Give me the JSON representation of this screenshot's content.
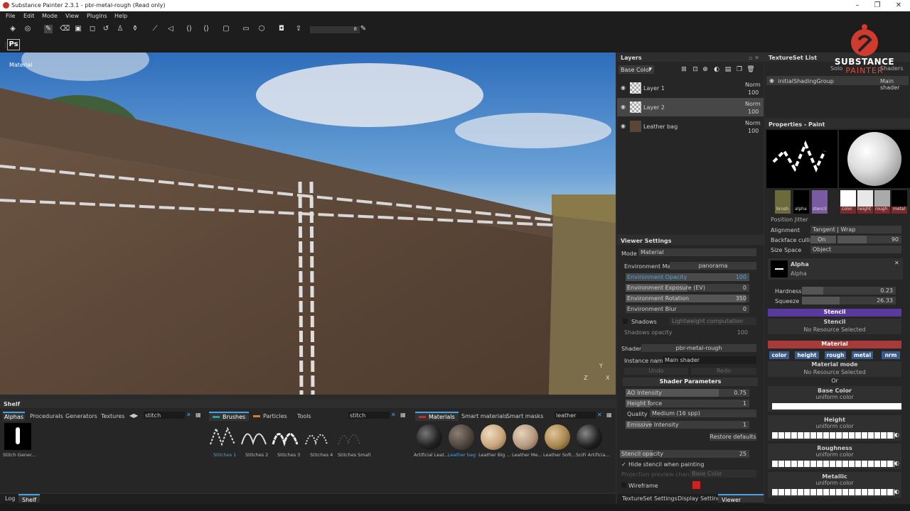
{
  "window": {
    "title": "Substance Painter 2.3.1 - pbr-metal-rough (Read only)",
    "min": "–",
    "max": "❐",
    "close": "✕"
  },
  "menu": [
    "File",
    "Edit",
    "Mode",
    "View",
    "Plugins",
    "Help"
  ],
  "toolbar": {
    "brush_size_value": "8",
    "ps_label": "Ps"
  },
  "viewport": {
    "label": "Material",
    "axis_z": "Z",
    "axis_x": "X",
    "axis_y": "Y"
  },
  "brand": {
    "line1": "SUBSTANCE",
    "line2": "PAINTER"
  },
  "layers": {
    "title": "Layers",
    "channel": "Base Color",
    "items": [
      {
        "name": "Layer 1",
        "blend": "Norm",
        "opacity": "100"
      },
      {
        "name": "Layer 2",
        "blend": "Norm",
        "opacity": "100"
      },
      {
        "name": "Leather bag",
        "blend": "Norm",
        "opacity": "100"
      }
    ]
  },
  "textureset": {
    "title": "TextureSet List",
    "solo": "Solo",
    "shaders": "Shaders",
    "item": "initialShadingGroup",
    "shader": "Main shader"
  },
  "properties": {
    "title": "Properties - Paint",
    "chips_left": [
      "brush",
      "alpha",
      "stencil"
    ],
    "chips_right": [
      "color",
      "height",
      "rough",
      "metal"
    ],
    "position_jitter": "Position Jitter",
    "alignment_label": "Alignment",
    "alignment_value": "Tangent | Wrap",
    "backface_label": "Backface culling",
    "backface_on": "On",
    "backface_value": "90",
    "sizespace_label": "Size Space",
    "sizespace_value": "Object",
    "alpha_title": "Alpha",
    "alpha_sub": "Alpha",
    "hardness_label": "Hardness",
    "hardness_value": "0.23",
    "squeeze_label": "Squeeze",
    "squeeze_value": "26.33",
    "stencil_header": "Stencil",
    "stencil_title": "Stencil",
    "stencil_none": "No Resource Selected",
    "material_header": "Material",
    "mat_buttons": [
      "color",
      "height",
      "rough",
      "metal",
      "nrm"
    ],
    "material_mode": "Material mode",
    "material_mode_none": "No Resource Selected",
    "or": "Or",
    "base_color": "Base Color",
    "base_color_sub": "uniform color",
    "height": "Height",
    "height_sub": "uniform color",
    "roughness": "Roughness",
    "roughness_sub": "uniform color",
    "metallic": "Metallic",
    "metallic_sub": "uniform color"
  },
  "viewer": {
    "title": "Viewer Settings",
    "mode_label": "Mode",
    "mode_value": "Material",
    "envmap_label": "Environment Map",
    "envmap_value": "panorama",
    "env_opacity_label": "Environment Opacity",
    "env_opacity_value": "100",
    "env_exposure_label": "Environment Exposure (EV)",
    "env_exposure_value": "0",
    "env_rotation_label": "Environment Rotation",
    "env_rotation_value": "350",
    "env_blur_label": "Environment Blur",
    "env_blur_value": "0",
    "shadows_label": "Shadows",
    "shadows_mode": "Lightweight computation",
    "shadows_opacity_label": "Shadows opacity",
    "shadows_opacity_value": "100",
    "shader_label": "Shader",
    "shader_value": "pbr-metal-rough",
    "instance_label": "Instance name",
    "instance_value": "Main shader",
    "undo": "Undo",
    "redo": "Redo",
    "shader_params": "Shader Parameters",
    "ao_label": "AO Intensity",
    "ao_value": "0.75",
    "height_force_label": "Height force",
    "height_force_value": "1",
    "quality_label": "Quality",
    "quality_value": "Medium (16 spp)",
    "emissive_label": "Emissive Intensity",
    "emissive_value": "1",
    "restore": "Restore defaults",
    "stencil_opacity_label": "Stencil opacity",
    "stencil_opacity_value": "25",
    "hide_stencil": "Hide stencil when painting",
    "proj_channel_label": "Projection preview channel",
    "proj_channel_value": "Base Color",
    "wireframe": "Wireframe"
  },
  "bottom_tabs": [
    "TextureSet Settings",
    "Display Settings",
    "Viewer Settings"
  ],
  "shelf": {
    "title": "Shelf",
    "alpha_tabs": [
      "Alphas",
      "Procedurals",
      "Generators",
      "Textures"
    ],
    "alpha_search": "stitch",
    "alpha_items": [
      "Stitch Gener..."
    ],
    "brush_tabs": [
      "Brushes",
      "Particles",
      "Tools"
    ],
    "brush_search": "stitch",
    "brush_items": [
      "Stitches 1",
      "Stitches 2",
      "Stitches 3",
      "Stitches 4",
      "Stitches Small"
    ],
    "mat_tabs": [
      "Materials",
      "Smart materials",
      "Smart masks"
    ],
    "mat_search": "leather",
    "mat_items": [
      "Artificial Leat...",
      "Leather bag",
      "Leather Big ...",
      "Leather Me...",
      "Leather Soft...",
      "SciFi Artificia..."
    ]
  },
  "statusbar": [
    "Log",
    "Shelf"
  ]
}
